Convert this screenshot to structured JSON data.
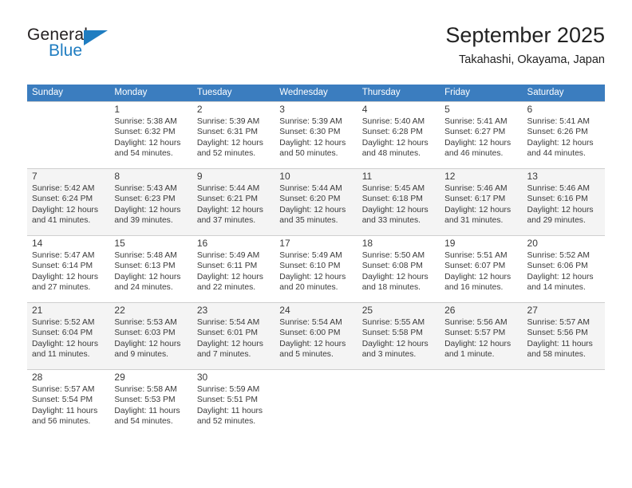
{
  "brand": {
    "general": "General",
    "blue": "Blue",
    "triangle_icon": "triangle-logo-icon"
  },
  "header": {
    "title": "September 2025",
    "subtitle": "Takahashi, Okayama, Japan"
  },
  "calendar": {
    "weekday_headers": [
      "Sunday",
      "Monday",
      "Tuesday",
      "Wednesday",
      "Thursday",
      "Friday",
      "Saturday"
    ],
    "header_bg": "#3b7dbf",
    "row_alt_bg": "#f4f4f4",
    "weeks": [
      [
        {
          "day": "",
          "sunrise": "",
          "sunset": "",
          "daylight_line1": "",
          "daylight_line2": ""
        },
        {
          "day": "1",
          "sunrise": "Sunrise: 5:38 AM",
          "sunset": "Sunset: 6:32 PM",
          "daylight_line1": "Daylight: 12 hours",
          "daylight_line2": "and 54 minutes."
        },
        {
          "day": "2",
          "sunrise": "Sunrise: 5:39 AM",
          "sunset": "Sunset: 6:31 PM",
          "daylight_line1": "Daylight: 12 hours",
          "daylight_line2": "and 52 minutes."
        },
        {
          "day": "3",
          "sunrise": "Sunrise: 5:39 AM",
          "sunset": "Sunset: 6:30 PM",
          "daylight_line1": "Daylight: 12 hours",
          "daylight_line2": "and 50 minutes."
        },
        {
          "day": "4",
          "sunrise": "Sunrise: 5:40 AM",
          "sunset": "Sunset: 6:28 PM",
          "daylight_line1": "Daylight: 12 hours",
          "daylight_line2": "and 48 minutes."
        },
        {
          "day": "5",
          "sunrise": "Sunrise: 5:41 AM",
          "sunset": "Sunset: 6:27 PM",
          "daylight_line1": "Daylight: 12 hours",
          "daylight_line2": "and 46 minutes."
        },
        {
          "day": "6",
          "sunrise": "Sunrise: 5:41 AM",
          "sunset": "Sunset: 6:26 PM",
          "daylight_line1": "Daylight: 12 hours",
          "daylight_line2": "and 44 minutes."
        }
      ],
      [
        {
          "day": "7",
          "sunrise": "Sunrise: 5:42 AM",
          "sunset": "Sunset: 6:24 PM",
          "daylight_line1": "Daylight: 12 hours",
          "daylight_line2": "and 41 minutes."
        },
        {
          "day": "8",
          "sunrise": "Sunrise: 5:43 AM",
          "sunset": "Sunset: 6:23 PM",
          "daylight_line1": "Daylight: 12 hours",
          "daylight_line2": "and 39 minutes."
        },
        {
          "day": "9",
          "sunrise": "Sunrise: 5:44 AM",
          "sunset": "Sunset: 6:21 PM",
          "daylight_line1": "Daylight: 12 hours",
          "daylight_line2": "and 37 minutes."
        },
        {
          "day": "10",
          "sunrise": "Sunrise: 5:44 AM",
          "sunset": "Sunset: 6:20 PM",
          "daylight_line1": "Daylight: 12 hours",
          "daylight_line2": "and 35 minutes."
        },
        {
          "day": "11",
          "sunrise": "Sunrise: 5:45 AM",
          "sunset": "Sunset: 6:18 PM",
          "daylight_line1": "Daylight: 12 hours",
          "daylight_line2": "and 33 minutes."
        },
        {
          "day": "12",
          "sunrise": "Sunrise: 5:46 AM",
          "sunset": "Sunset: 6:17 PM",
          "daylight_line1": "Daylight: 12 hours",
          "daylight_line2": "and 31 minutes."
        },
        {
          "day": "13",
          "sunrise": "Sunrise: 5:46 AM",
          "sunset": "Sunset: 6:16 PM",
          "daylight_line1": "Daylight: 12 hours",
          "daylight_line2": "and 29 minutes."
        }
      ],
      [
        {
          "day": "14",
          "sunrise": "Sunrise: 5:47 AM",
          "sunset": "Sunset: 6:14 PM",
          "daylight_line1": "Daylight: 12 hours",
          "daylight_line2": "and 27 minutes."
        },
        {
          "day": "15",
          "sunrise": "Sunrise: 5:48 AM",
          "sunset": "Sunset: 6:13 PM",
          "daylight_line1": "Daylight: 12 hours",
          "daylight_line2": "and 24 minutes."
        },
        {
          "day": "16",
          "sunrise": "Sunrise: 5:49 AM",
          "sunset": "Sunset: 6:11 PM",
          "daylight_line1": "Daylight: 12 hours",
          "daylight_line2": "and 22 minutes."
        },
        {
          "day": "17",
          "sunrise": "Sunrise: 5:49 AM",
          "sunset": "Sunset: 6:10 PM",
          "daylight_line1": "Daylight: 12 hours",
          "daylight_line2": "and 20 minutes."
        },
        {
          "day": "18",
          "sunrise": "Sunrise: 5:50 AM",
          "sunset": "Sunset: 6:08 PM",
          "daylight_line1": "Daylight: 12 hours",
          "daylight_line2": "and 18 minutes."
        },
        {
          "day": "19",
          "sunrise": "Sunrise: 5:51 AM",
          "sunset": "Sunset: 6:07 PM",
          "daylight_line1": "Daylight: 12 hours",
          "daylight_line2": "and 16 minutes."
        },
        {
          "day": "20",
          "sunrise": "Sunrise: 5:52 AM",
          "sunset": "Sunset: 6:06 PM",
          "daylight_line1": "Daylight: 12 hours",
          "daylight_line2": "and 14 minutes."
        }
      ],
      [
        {
          "day": "21",
          "sunrise": "Sunrise: 5:52 AM",
          "sunset": "Sunset: 6:04 PM",
          "daylight_line1": "Daylight: 12 hours",
          "daylight_line2": "and 11 minutes."
        },
        {
          "day": "22",
          "sunrise": "Sunrise: 5:53 AM",
          "sunset": "Sunset: 6:03 PM",
          "daylight_line1": "Daylight: 12 hours",
          "daylight_line2": "and 9 minutes."
        },
        {
          "day": "23",
          "sunrise": "Sunrise: 5:54 AM",
          "sunset": "Sunset: 6:01 PM",
          "daylight_line1": "Daylight: 12 hours",
          "daylight_line2": "and 7 minutes."
        },
        {
          "day": "24",
          "sunrise": "Sunrise: 5:54 AM",
          "sunset": "Sunset: 6:00 PM",
          "daylight_line1": "Daylight: 12 hours",
          "daylight_line2": "and 5 minutes."
        },
        {
          "day": "25",
          "sunrise": "Sunrise: 5:55 AM",
          "sunset": "Sunset: 5:58 PM",
          "daylight_line1": "Daylight: 12 hours",
          "daylight_line2": "and 3 minutes."
        },
        {
          "day": "26",
          "sunrise": "Sunrise: 5:56 AM",
          "sunset": "Sunset: 5:57 PM",
          "daylight_line1": "Daylight: 12 hours",
          "daylight_line2": "and 1 minute."
        },
        {
          "day": "27",
          "sunrise": "Sunrise: 5:57 AM",
          "sunset": "Sunset: 5:56 PM",
          "daylight_line1": "Daylight: 11 hours",
          "daylight_line2": "and 58 minutes."
        }
      ],
      [
        {
          "day": "28",
          "sunrise": "Sunrise: 5:57 AM",
          "sunset": "Sunset: 5:54 PM",
          "daylight_line1": "Daylight: 11 hours",
          "daylight_line2": "and 56 minutes."
        },
        {
          "day": "29",
          "sunrise": "Sunrise: 5:58 AM",
          "sunset": "Sunset: 5:53 PM",
          "daylight_line1": "Daylight: 11 hours",
          "daylight_line2": "and 54 minutes."
        },
        {
          "day": "30",
          "sunrise": "Sunrise: 5:59 AM",
          "sunset": "Sunset: 5:51 PM",
          "daylight_line1": "Daylight: 11 hours",
          "daylight_line2": "and 52 minutes."
        },
        {
          "day": "",
          "sunrise": "",
          "sunset": "",
          "daylight_line1": "",
          "daylight_line2": ""
        },
        {
          "day": "",
          "sunrise": "",
          "sunset": "",
          "daylight_line1": "",
          "daylight_line2": ""
        },
        {
          "day": "",
          "sunrise": "",
          "sunset": "",
          "daylight_line1": "",
          "daylight_line2": ""
        },
        {
          "day": "",
          "sunrise": "",
          "sunset": "",
          "daylight_line1": "",
          "daylight_line2": ""
        }
      ]
    ]
  }
}
